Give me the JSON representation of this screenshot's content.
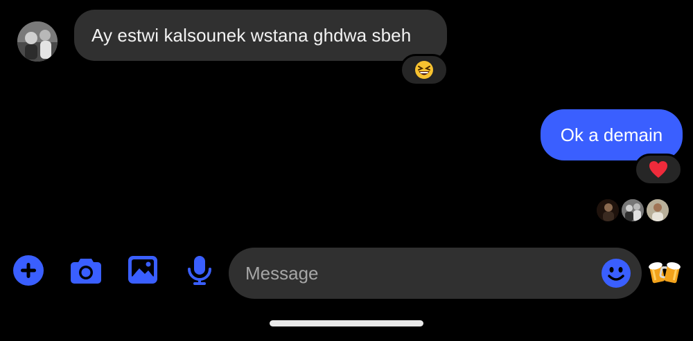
{
  "thread": {
    "incoming_message": {
      "text": "Ay estwi kalsounek wstana ghdwa sbeh",
      "reaction": "laughing-face-emoji"
    },
    "outgoing_message": {
      "text": "Ok a demain",
      "reaction": "red-heart-emoji"
    },
    "read_receipts": [
      "avatar-participant-1",
      "avatar-participant-2",
      "avatar-participant-3"
    ]
  },
  "composer": {
    "placeholder": "Message",
    "tools": [
      "plus-icon",
      "camera-icon",
      "image-icon",
      "microphone-icon"
    ],
    "emoji_button": "smiley-icon",
    "quick_reaction": "beer-mugs-emoji"
  },
  "colors": {
    "background": "#000000",
    "incoming_bubble": "#303030",
    "outgoing_bubble": "#3a5fff",
    "accent": "#3a5fff",
    "composer": "#303030"
  }
}
